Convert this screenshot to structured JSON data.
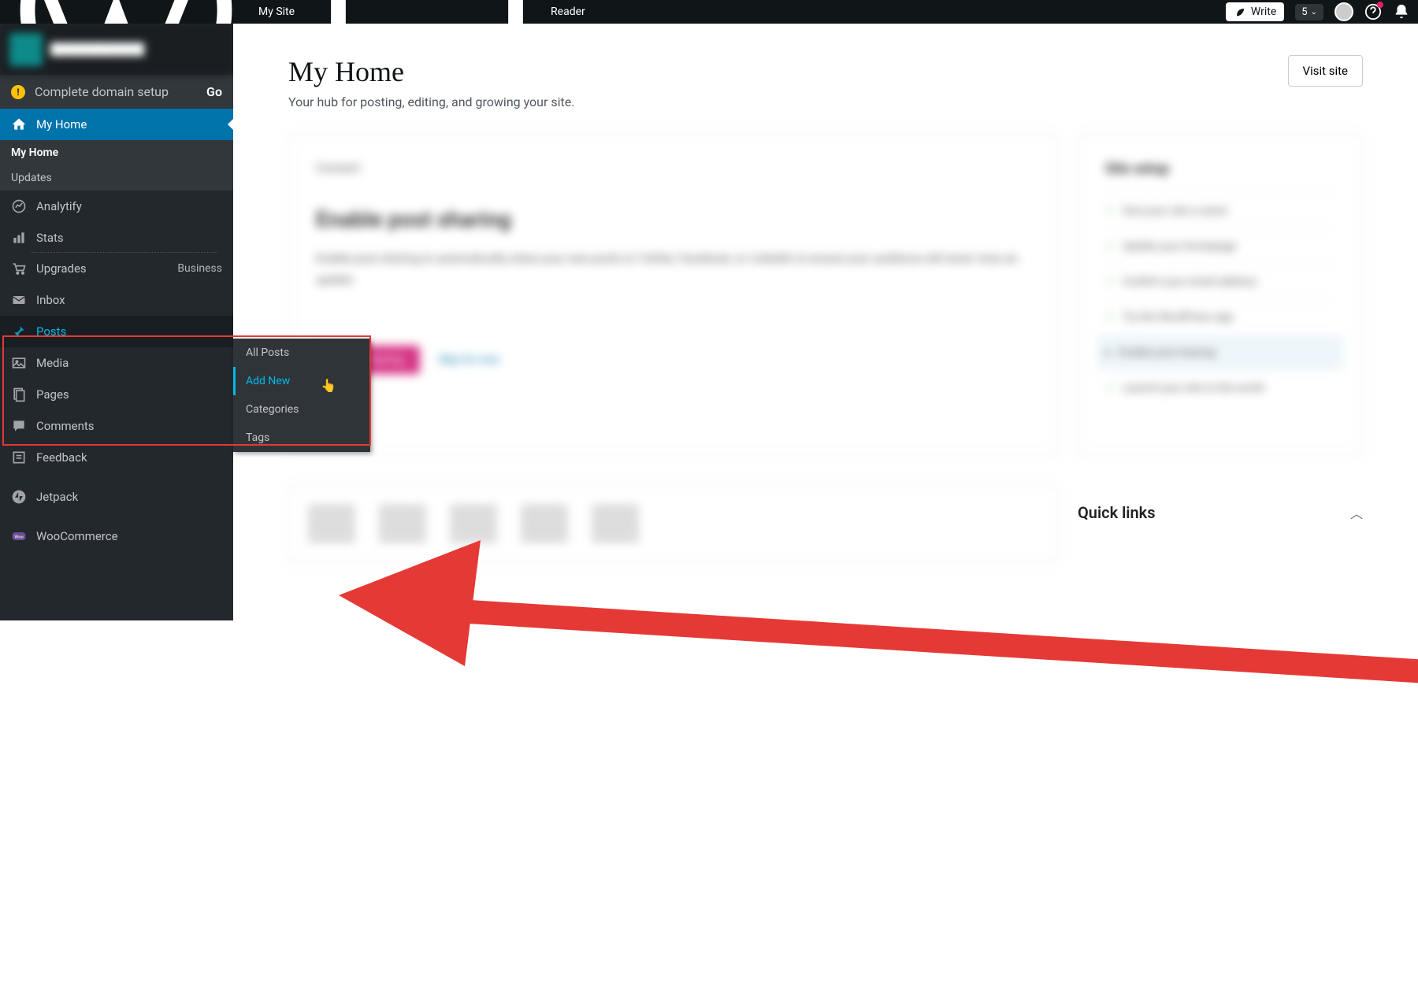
{
  "topbar": {
    "my_site": "My Site",
    "reader": "Reader",
    "write": "Write",
    "count": "5"
  },
  "sidebar": {
    "notice": "Complete domain setup",
    "go": "Go",
    "my_home": "My Home",
    "sub_my_home": "My Home",
    "sub_updates": "Updates",
    "analytify": "Analytify",
    "stats": "Stats",
    "upgrades": "Upgrades",
    "upgrades_plan": "Business",
    "inbox": "Inbox",
    "posts": "Posts",
    "media": "Media",
    "pages": "Pages",
    "comments": "Comments",
    "feedback": "Feedback",
    "jetpack": "Jetpack",
    "woocommerce": "WooCommerce"
  },
  "flyout": {
    "all_posts": "All Posts",
    "add_new": "Add New",
    "categories": "Categories",
    "tags": "Tags"
  },
  "page": {
    "title": "My Home",
    "subtitle": "Your hub for posting, editing, and growing your site.",
    "visit": "Visit site"
  },
  "card": {
    "section": "Connect",
    "heading": "Enable post sharing",
    "body": "Enable post sharing to automatically share your new posts to Twitter, Facebook, or LinkedIn to ensure your audience will never miss an update.",
    "enable": "Enable sharing",
    "skip": "Skip for now"
  },
  "setup": {
    "title": "Site setup",
    "i1": "Give your site a name",
    "i2": "Update your homepage",
    "i3": "Confirm your email address",
    "i4": "Try the WordPress app",
    "i5": "Enable post sharing",
    "i6": "Launch your site to the world"
  },
  "quicklinks": {
    "title": "Quick links"
  }
}
